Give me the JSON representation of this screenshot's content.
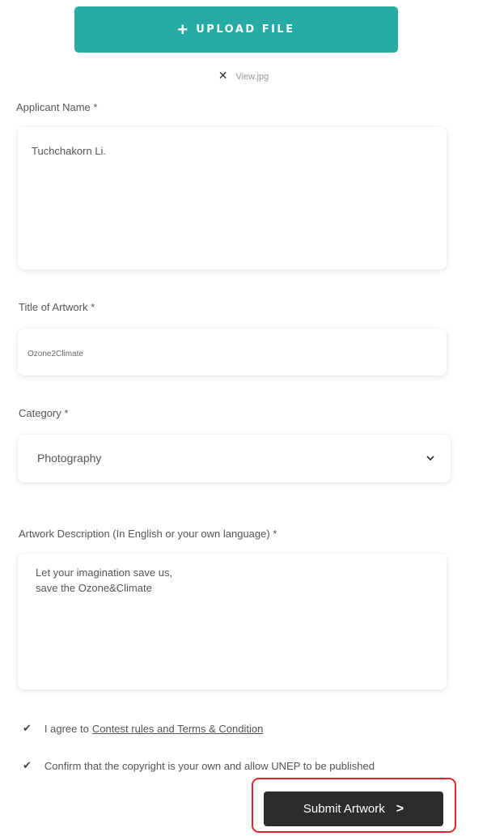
{
  "upload": {
    "icon": "plus-icon",
    "label": "UPLOAD FILE"
  },
  "file": {
    "remove_icon": "close-icon",
    "name": "View.jpg"
  },
  "applicant": {
    "label": "Applicant Name *",
    "value": "Tuchchakorn Li."
  },
  "title": {
    "label": "Title of Artwork *",
    "value": "Ozone2Climate"
  },
  "category": {
    "label": "Category *",
    "value": "Photography",
    "icon": "chevron-down-icon"
  },
  "description": {
    "label": "Artwork Description (In English or your own language) *",
    "value": "Let your imagination save us,\nsave the Ozone&Climate"
  },
  "agreements": [
    {
      "icon": "check-icon",
      "text": "I agree to",
      "link": "Contest rules and Terms & Condition"
    },
    {
      "icon": "check-icon",
      "text": "Confirm that the copyright is your own and allow UNEP to be published"
    }
  ],
  "submit": {
    "label": "Submit Artwork",
    "icon": "chevron-right-icon"
  },
  "colors": {
    "accent": "#27aba4",
    "submit": "#2c2c2c",
    "highlight": "#e0282a"
  }
}
